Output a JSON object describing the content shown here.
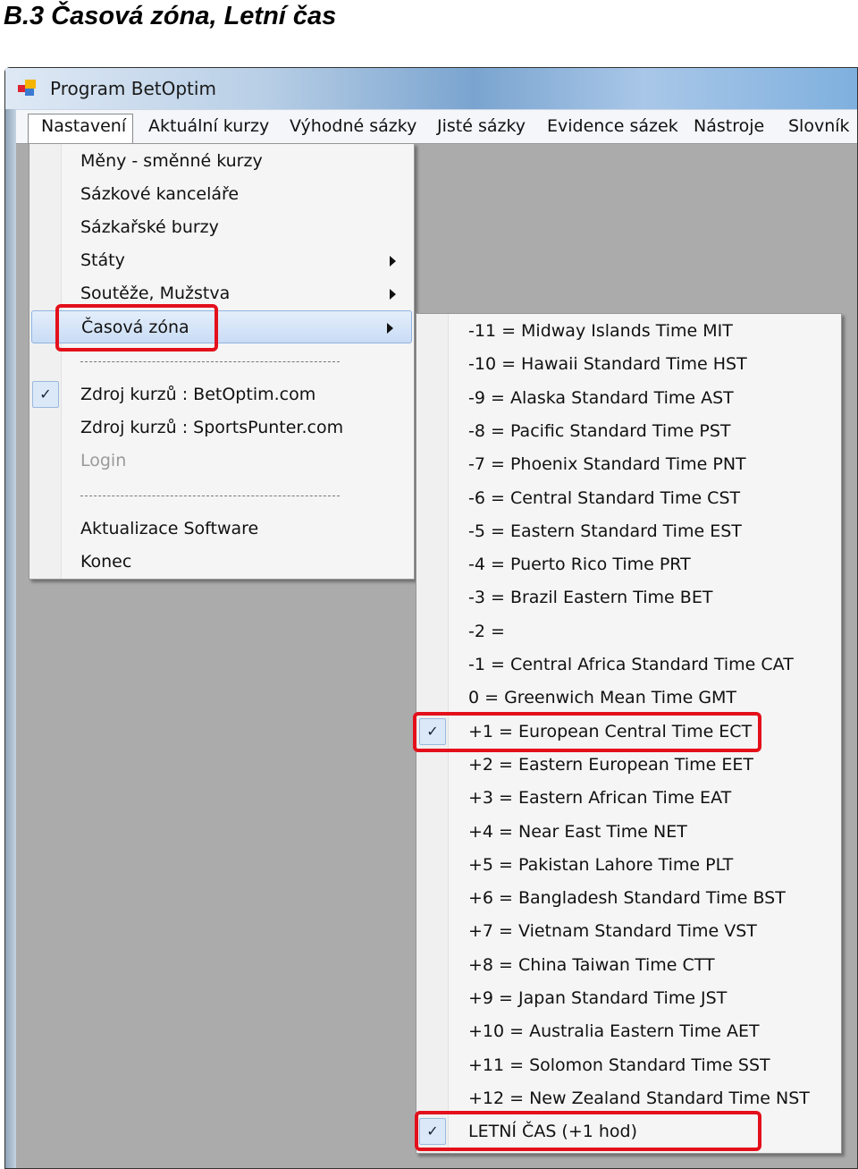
{
  "heading": "B.3  Časová zóna, Letní čas",
  "window": {
    "title": "Program BetOptim",
    "app_icon": "windows-forms-app-icon"
  },
  "menubar": [
    "Nastavení",
    "Aktuální kurzy",
    "Výhodné sázky",
    "Jisté sázky",
    "Evidence sázek",
    "Nástroje",
    "Slovník"
  ],
  "menu_nastaveni": {
    "items": [
      {
        "label": "Měny - směnné kurzy"
      },
      {
        "label": "Sázkové kanceláře"
      },
      {
        "label": "Sázkařské burzy"
      },
      {
        "label": "Státy",
        "submenu": true
      },
      {
        "label": "Soutěže, Mužstva",
        "submenu": true
      },
      {
        "label": "Časová zóna",
        "submenu": true,
        "highlighted": true
      },
      {
        "separator": true
      },
      {
        "label": "Zdroj kurzů : BetOptim.com",
        "checked": true
      },
      {
        "label": "Zdroj kurzů : SportsPunter.com"
      },
      {
        "label": "Login",
        "disabled": true
      },
      {
        "separator": true
      },
      {
        "label": "Aktualizace Software"
      },
      {
        "label": "Konec"
      }
    ]
  },
  "menu_casova_zona": {
    "items": [
      {
        "label": "-11 = Midway Islands Time MIT"
      },
      {
        "label": "-10 = Hawaii Standard Time HST"
      },
      {
        "label": "-9 = Alaska Standard Time AST"
      },
      {
        "label": "-8 = Pacific Standard Time PST"
      },
      {
        "label": "-7 = Phoenix Standard Time PNT"
      },
      {
        "label": "-6 = Central Standard Time CST"
      },
      {
        "label": "-5 = Eastern Standard Time EST"
      },
      {
        "label": "-4 = Puerto Rico Time PRT"
      },
      {
        "label": "-3 = Brazil Eastern Time BET"
      },
      {
        "label": "-2 ="
      },
      {
        "label": "-1 = Central Africa Standard Time CAT"
      },
      {
        "label": "0 = Greenwich Mean Time GMT"
      },
      {
        "label": "+1 = European Central Time ECT",
        "checked": true
      },
      {
        "label": "+2 = Eastern European Time EET"
      },
      {
        "label": "+3 = Eastern African Time EAT"
      },
      {
        "label": "+4 = Near East Time NET"
      },
      {
        "label": "+5 = Pakistan Lahore Time PLT"
      },
      {
        "label": "+6 = Bangladesh Standard Time BST"
      },
      {
        "label": "+7 = Vietnam Standard Time VST"
      },
      {
        "label": "+8 = China Taiwan Time CTT"
      },
      {
        "label": "+9 = Japan Standard Time JST"
      },
      {
        "label": "+10 = Australia Eastern Time AET"
      },
      {
        "label": "+11 = Solomon Standard Time SST"
      },
      {
        "label": "+12 = New Zealand Standard Time NST"
      },
      {
        "label": "LETNÍ ČAS (+1 hod)",
        "checked": true
      }
    ]
  },
  "check_glyph": "✓",
  "colors": {
    "highlight_box": "#e3101b",
    "client_bg": "#ababab",
    "menu_bg": "#f5f5f5"
  }
}
